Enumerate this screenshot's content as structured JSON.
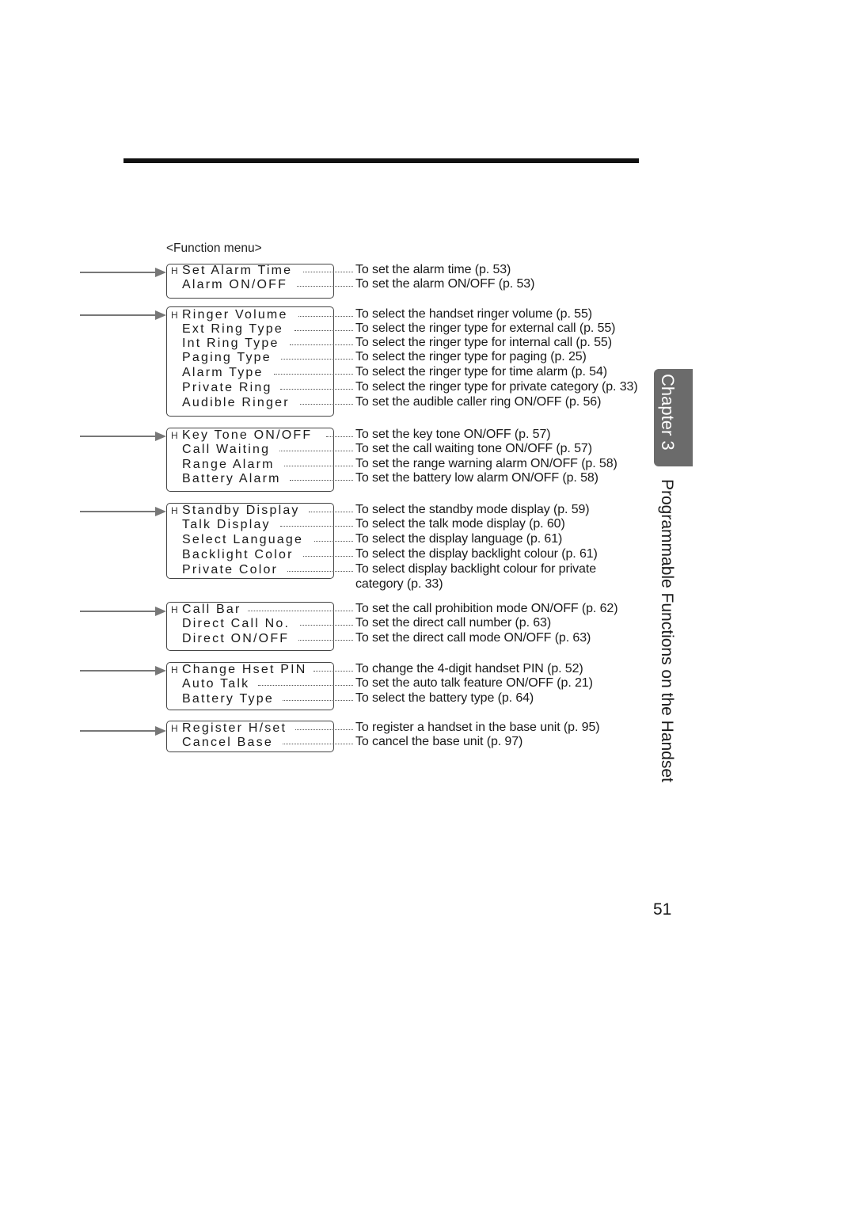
{
  "header": {
    "rule": "top-rule"
  },
  "menu": {
    "title": "<Function menu>",
    "cursor_glyph": "H",
    "groups": [
      {
        "items": [
          {
            "label": "Set Alarm Time",
            "desc": "To set the alarm time (p. 53)"
          },
          {
            "label": "Alarm ON/OFF",
            "desc": "To set the alarm ON/OFF (p. 53)"
          }
        ]
      },
      {
        "items": [
          {
            "label": "Ringer Volume",
            "desc": "To select the handset ringer volume (p. 55)"
          },
          {
            "label": "Ext Ring Type",
            "desc": "To select the ringer type for external call (p. 55)"
          },
          {
            "label": "Int Ring Type",
            "desc": "To select the ringer type for internal call (p. 55)"
          },
          {
            "label": "Paging Type",
            "desc": "To select the ringer type for paging (p. 25)"
          },
          {
            "label": "Alarm Type",
            "desc": "To select the ringer type for time alarm (p. 54)"
          },
          {
            "label": "Private Ring",
            "desc": "To select the ringer type for private category (p. 33)"
          },
          {
            "label": "Audible Ringer",
            "desc": "To set the audible caller ring ON/OFF (p. 56)"
          }
        ]
      },
      {
        "items": [
          {
            "label": "Key Tone ON/OFF",
            "desc": "To set the key tone ON/OFF (p. 57)"
          },
          {
            "label": "Call Waiting",
            "desc": "To set the call waiting tone ON/OFF (p. 57)"
          },
          {
            "label": "Range Alarm",
            "desc": "To set the range warning alarm ON/OFF (p. 58)"
          },
          {
            "label": "Battery Alarm",
            "desc": "To set the battery low alarm ON/OFF (p. 58)"
          }
        ]
      },
      {
        "items": [
          {
            "label": "Standby Display",
            "desc": "To select the standby mode display (p. 59)"
          },
          {
            "label": "Talk Display",
            "desc": "To select the talk mode display (p. 60)"
          },
          {
            "label": "Select Language",
            "desc": "To select the display language (p. 61)"
          },
          {
            "label": "Backlight Color",
            "desc": "To select the display backlight colour (p. 61)"
          },
          {
            "label": "Private Color",
            "desc": "To select display backlight colour for private",
            "desc_cont": "category (p. 33)"
          }
        ]
      },
      {
        "items": [
          {
            "label": "Call Bar",
            "desc": "To set the call prohibition mode ON/OFF (p. 62)"
          },
          {
            "label": "Direct Call No.",
            "desc": "To set the direct call number (p. 63)"
          },
          {
            "label": "Direct ON/OFF",
            "desc": "To set the direct call mode ON/OFF (p. 63)"
          }
        ]
      },
      {
        "items": [
          {
            "label": "Change Hset PIN",
            "desc": "To change the 4-digit handset PIN (p. 52)"
          },
          {
            "label": "Auto Talk",
            "desc": "To set the auto talk feature ON/OFF (p. 21)"
          },
          {
            "label": "Battery Type",
            "desc": "To select the battery type (p. 64)"
          }
        ]
      },
      {
        "items": [
          {
            "label": "Register H/set",
            "desc": "To register a handset in the base unit (p. 95)"
          },
          {
            "label": "Cancel Base",
            "desc": "To cancel the base unit (p. 97)"
          }
        ]
      }
    ]
  },
  "side_tab": {
    "chapter": "Chapter 3",
    "section": "Programmable Functions on the Handset"
  },
  "footer": {
    "page_number": "51"
  },
  "colors": {
    "tab_bg": "#6b6b6b",
    "arrow": "#777777",
    "text": "#1a1a1a"
  }
}
